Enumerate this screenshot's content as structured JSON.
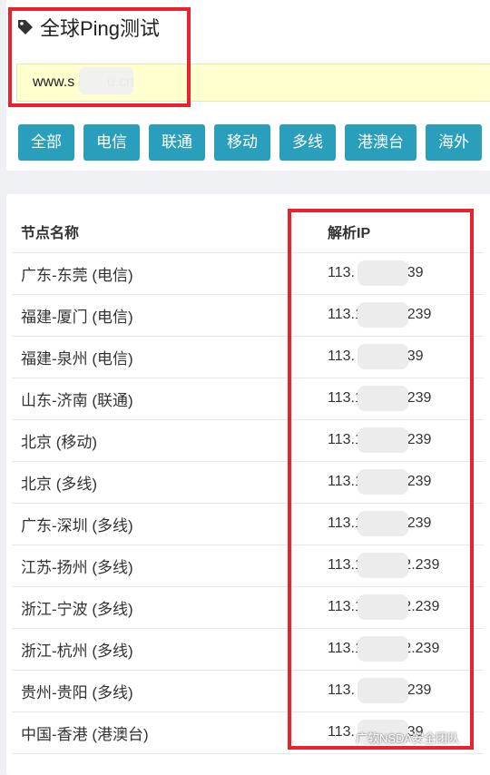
{
  "header": {
    "title": "全球Ping测试",
    "icon": "tag-icon"
  },
  "domain_input": {
    "value": "www.s        u.cn"
  },
  "filters": [
    "全部",
    "电信",
    "联通",
    "移动",
    "多线",
    "港澳台",
    "海外"
  ],
  "table": {
    "columns": [
      "节点名称",
      "解析IP"
    ],
    "rows": [
      {
        "name": "广东-东莞 (电信)",
        "ip": "113.          .239"
      },
      {
        "name": "福建-厦门 (电信)",
        "ip": "113.1          .239"
      },
      {
        "name": "福建-泉州 (电信)",
        "ip": "113.          .239"
      },
      {
        "name": "山东-济南 (联通)",
        "ip": "113.1          .239"
      },
      {
        "name": "北京 (移动)",
        "ip": "113.1          .239"
      },
      {
        "name": "北京 (多线)",
        "ip": "113.1          .239"
      },
      {
        "name": "广东-深圳 (多线)",
        "ip": "113.1          .239"
      },
      {
        "name": "江苏-扬州 (多线)",
        "ip": "113.1          2.239"
      },
      {
        "name": "浙江-宁波 (多线)",
        "ip": "113.1          2.239"
      },
      {
        "name": "浙江-杭州 (多线)",
        "ip": "113.1          2.239"
      },
      {
        "name": "贵州-贵阳 (多线)",
        "ip": "113.          2.239"
      },
      {
        "name": "中国-香港 (港澳台)",
        "ip": "113.          .239"
      }
    ]
  },
  "watermark": "广软NSDA安全团队",
  "colors": {
    "button_bg": "#2a9fbc",
    "input_bg": "#ffffd0",
    "annotation_red": "#e8232f",
    "page_bg": "#eef0f4"
  }
}
